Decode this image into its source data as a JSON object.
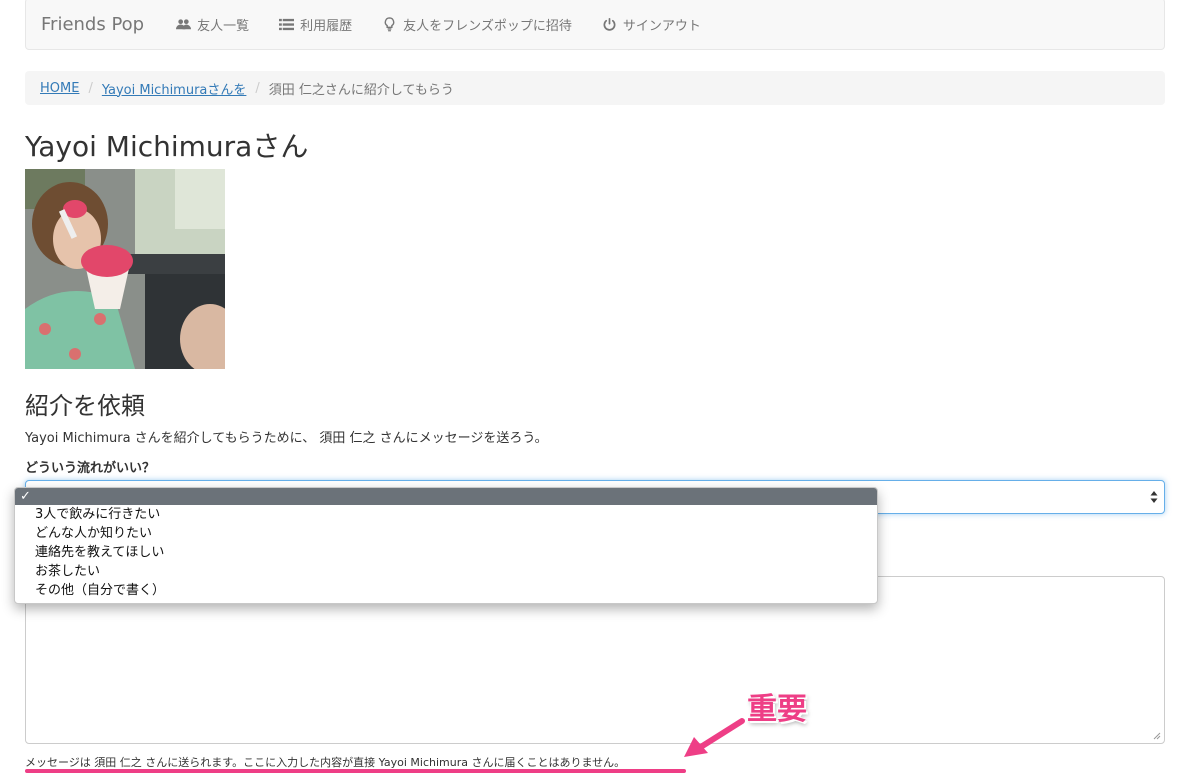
{
  "navbar": {
    "brand": "Friends Pop",
    "items": [
      {
        "label": "友人一覧",
        "icon": "users-icon"
      },
      {
        "label": "利用履歴",
        "icon": "list-icon"
      },
      {
        "label": "友人をフレンズポップに招待",
        "icon": "lightbulb-icon"
      },
      {
        "label": "サインアウト",
        "icon": "power-icon"
      }
    ]
  },
  "breadcrumb": {
    "home": "HOME",
    "person": "Yayoi Michimuraさんを",
    "current": "須田 仁之さんに紹介してもらう",
    "separator": "/"
  },
  "page_title": "Yayoi Michimuraさん",
  "section_title": "紹介を依頼",
  "intro_text": "Yayoi Michimura さんを紹介してもらうために、 須田 仁之 さんにメッセージを送ろう。",
  "flow_label": "どういう流れがいい？",
  "dropdown": {
    "selected_mark": "✓",
    "options": [
      "3人で飲みに行きたい",
      "どんな人か知りたい",
      "連絡先を教えてほしい",
      "お茶したい",
      "その他（自分で書く）"
    ]
  },
  "footer_note": "メッセージは 須田 仁之 さんに送られます。ここに入力した内容が直接 Yayoi Michimura さんに届くことはありません。",
  "annotation": {
    "label": "重要"
  },
  "colors": {
    "accent": "#ee3e86",
    "link": "#337ab7",
    "nav_text": "#777777"
  }
}
